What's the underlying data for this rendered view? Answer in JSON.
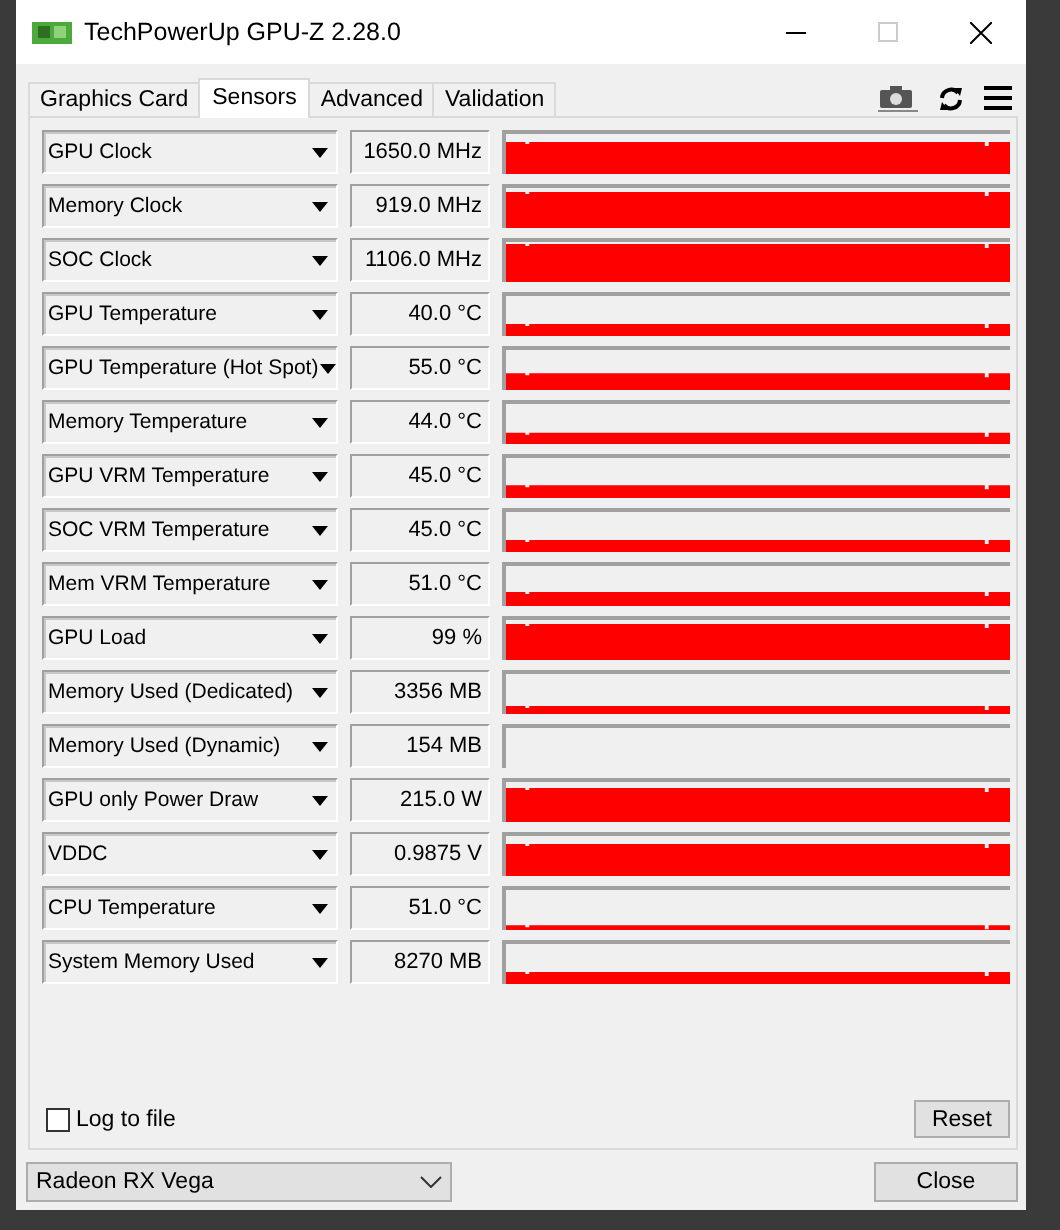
{
  "window": {
    "title": "TechPowerUp GPU-Z 2.28.0"
  },
  "tabs": [
    {
      "label": "Graphics Card",
      "selected": false
    },
    {
      "label": "Sensors",
      "selected": true
    },
    {
      "label": "Advanced",
      "selected": false
    },
    {
      "label": "Validation",
      "selected": false
    }
  ],
  "sensors": [
    {
      "name": "GPU Clock",
      "reading": "1650.0 MHz"
    },
    {
      "name": "Memory Clock",
      "reading": "919.0 MHz"
    },
    {
      "name": "SOC Clock",
      "reading": "1106.0 MHz"
    },
    {
      "name": "GPU Temperature",
      "reading": "40.0 °C"
    },
    {
      "name": "GPU Temperature (Hot Spot)",
      "reading": "55.0 °C"
    },
    {
      "name": "Memory Temperature",
      "reading": "44.0 °C"
    },
    {
      "name": "GPU VRM Temperature",
      "reading": "45.0 °C"
    },
    {
      "name": "SOC VRM Temperature",
      "reading": "45.0 °C"
    },
    {
      "name": "Mem VRM Temperature",
      "reading": "51.0 °C"
    },
    {
      "name": "GPU Load",
      "reading": "99 %"
    },
    {
      "name": "Memory Used (Dedicated)",
      "reading": "3356 MB"
    },
    {
      "name": "Memory Used (Dynamic)",
      "reading": "154 MB"
    },
    {
      "name": "GPU only Power Draw",
      "reading": "215.0 W"
    },
    {
      "name": "VDDC",
      "reading": "0.9875 V"
    },
    {
      "name": "CPU Temperature",
      "reading": "51.0 °C"
    },
    {
      "name": "System Memory Used",
      "reading": "8270 MB"
    }
  ],
  "log_to_file": {
    "label": "Log to file",
    "checked": false
  },
  "reset_button": "Reset",
  "gpu_select": {
    "value": "Radeon RX Vega"
  },
  "close_button": "Close"
}
